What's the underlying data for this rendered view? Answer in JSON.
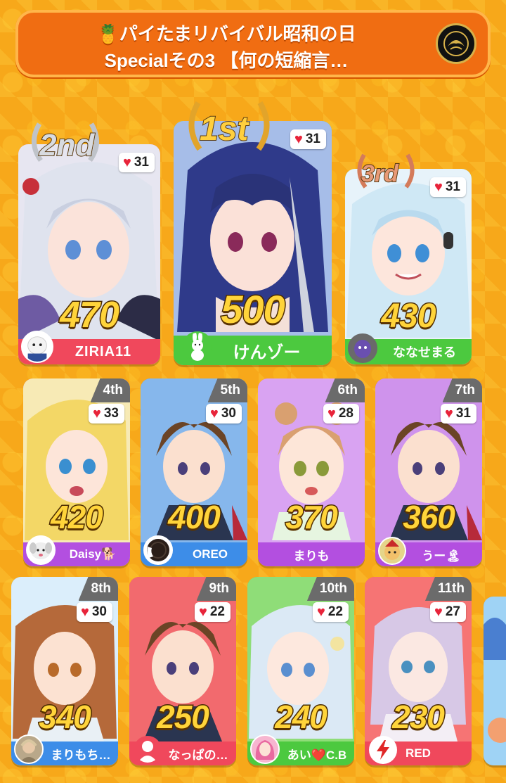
{
  "header": {
    "line1": "🍍パイたまリバイバル昭和の日",
    "line2": "Specialその3 【何の短縮言…"
  },
  "top3": [
    {
      "rank_label": "1st",
      "likes": "31",
      "score": "500",
      "name": "けんゾー",
      "bar_color": "#4cc93f",
      "art_bg": "#8fa9e8",
      "hair": "#2f3a8a"
    },
    {
      "rank_label": "2nd",
      "likes": "31",
      "score": "470",
      "name": "ZIRIA11",
      "bar_color": "#f0485c",
      "art_bg": "#e5e5f0",
      "hair": "#dfe3ee"
    },
    {
      "rank_label": "3rd",
      "likes": "31",
      "score": "430",
      "name": "ななせまる",
      "bar_color": "#4cc93f",
      "art_bg": "#dff1fa",
      "hair": "#cfe8f5"
    }
  ],
  "row2": [
    {
      "rank_label": "4th",
      "likes": "33",
      "score": "420",
      "name": "Daisy🐕",
      "bar_color": "#b34fe0",
      "art_bg": "#f5e7a8",
      "hair": "#f3d766"
    },
    {
      "rank_label": "5th",
      "likes": "30",
      "score": "400",
      "name": "OREO",
      "bar_color": "#3d8de8",
      "art_bg": "#7fb2ea",
      "hair": "#6b4426"
    },
    {
      "rank_label": "6th",
      "likes": "28",
      "score": "370",
      "name": "まりも",
      "bar_color": "#b34fe0",
      "art_bg": "#d59bf0",
      "hair": "#d9a070"
    },
    {
      "rank_label": "7th",
      "likes": "31",
      "score": "360",
      "name": "うー🏝",
      "bar_color": "#b34fe0",
      "art_bg": "#c98de8",
      "hair": "#6b4426"
    }
  ],
  "row3": [
    {
      "rank_label": "8th",
      "likes": "30",
      "score": "340",
      "name": "まりもち…",
      "bar_color": "#3d8de8",
      "art_bg": "#d9ecfa",
      "hair": "#b5693a"
    },
    {
      "rank_label": "9th",
      "likes": "22",
      "score": "250",
      "name": "なっぱの…",
      "bar_color": "#f0485c",
      "art_bg": "#f0656a",
      "hair": "#6b4426"
    },
    {
      "rank_label": "10th",
      "likes": "22",
      "score": "240",
      "name": "あい❤️C.B",
      "bar_color": "#4cc93f",
      "art_bg": "#7fd96a",
      "hair": "#dbe9f5"
    },
    {
      "rank_label": "11th",
      "likes": "27",
      "score": "230",
      "name": "RED",
      "bar_color": "#f0485c",
      "art_bg": "#f57070",
      "hair": "#d7c8e6"
    }
  ]
}
